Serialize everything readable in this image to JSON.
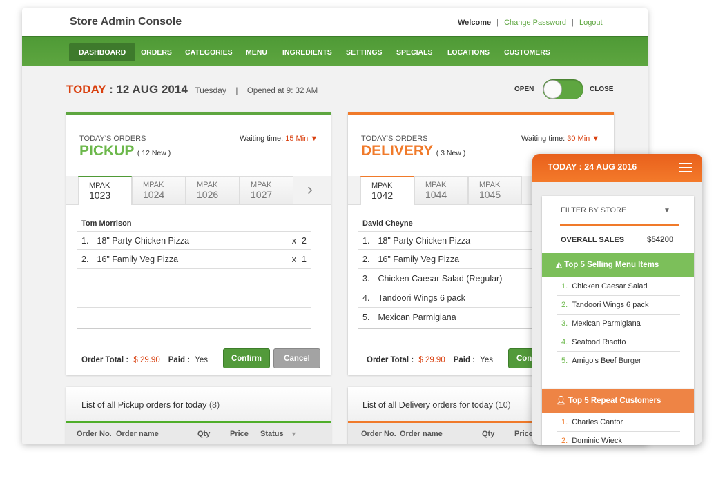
{
  "header": {
    "title": "Store Admin Console",
    "welcome": "Welcome",
    "sep": "|",
    "change_password": "Change Password",
    "logout": "Logout"
  },
  "nav": [
    "DASHBOARD",
    "ORDERS",
    "CATEGORIES",
    "MENU",
    "INGREDIENTS",
    "SETTINGS",
    "SPECIALS",
    "LOCATIONS",
    "CUSTOMERS"
  ],
  "date": {
    "today": "TODAY",
    "date": ": 12 AUG 2014",
    "day": "Tuesday",
    "sep": "|",
    "opened": "Opened at 9: 32 AM"
  },
  "toggle": {
    "open": "OPEN",
    "close": "CLOSE",
    "state": "open"
  },
  "pickup": {
    "subtitle": "TODAY'S ORDERS",
    "title": "PICKUP",
    "new": "( 12 New )",
    "waiting_label": "Waiting time:",
    "waiting": "15 Min",
    "tabs": [
      {
        "a": "MPAK",
        "b": "1023"
      },
      {
        "a": "MPAK",
        "b": "1024"
      },
      {
        "a": "MPAK",
        "b": "1026"
      },
      {
        "a": "MPAK",
        "b": "1027"
      }
    ],
    "customer": "Tom Morrison",
    "items": [
      {
        "n": "1.",
        "name": "18\" Party Chicken Pizza",
        "x": "x",
        "qty": "2"
      },
      {
        "n": "2.",
        "name": "16\" Family Veg Pizza",
        "x": "x",
        "qty": "1"
      }
    ],
    "total_label": "Order Total :",
    "total": "$ 29.90",
    "paid_label": "Paid :",
    "paid": "Yes",
    "confirm": "Confirm",
    "cancel": "Cancel"
  },
  "delivery": {
    "subtitle": "TODAY'S ORDERS",
    "title": "DELIVERY",
    "new": "( 3 New )",
    "waiting_label": "Waiting time:",
    "waiting": "30 Min",
    "tabs": [
      {
        "a": "MPAK",
        "b": "1042"
      },
      {
        "a": "MPAK",
        "b": "1044"
      },
      {
        "a": "MPAK",
        "b": "1045"
      }
    ],
    "customer": "David Cheyne",
    "items": [
      {
        "n": "1.",
        "name": "18\" Party Chicken Pizza"
      },
      {
        "n": "2.",
        "name": "16\" Family Veg Pizza"
      },
      {
        "n": "3.",
        "name": "Chicken Caesar Salad (Regular)"
      },
      {
        "n": "4.",
        "name": "Tandoori Wings 6 pack"
      },
      {
        "n": "5.",
        "name": "Mexican Parmigiana"
      }
    ],
    "total_label": "Order Total :",
    "total": "$ 29.90",
    "paid_label": "Paid :",
    "paid": "Yes",
    "confirm": "Confirm"
  },
  "pickup_list": {
    "title": "List of all Pickup orders for today",
    "count": "(8)",
    "cols": [
      "Order No.",
      "Order name",
      "Qty",
      "Price",
      "Status"
    ]
  },
  "delivery_list": {
    "title": "List of all Delivery orders for today",
    "count": "(10)",
    "cols": [
      "Order No.",
      "Order name",
      "Qty",
      "Price"
    ]
  },
  "mobile": {
    "date": "TODAY : 24 AUG 2016",
    "filter": "FILTER BY STORE",
    "sales_label": "OVERALL SALES",
    "sales": "$54200",
    "top_items_title": "Top 5 Selling Menu Items",
    "top_items": [
      {
        "n": "1.",
        "name": "Chicken Caesar Salad"
      },
      {
        "n": "2.",
        "name": "Tandoori Wings 6 pack"
      },
      {
        "n": "3.",
        "name": "Mexican Parmigiana"
      },
      {
        "n": "4.",
        "name": "Seafood Risotto"
      },
      {
        "n": "5.",
        "name": "Amigo's Beef Burger"
      }
    ],
    "customers_title": "Top 5 Repeat Customers",
    "customers": [
      {
        "n": "1.",
        "name": "Charles Cantor"
      },
      {
        "n": "2.",
        "name": "Dominic Wieck"
      }
    ]
  },
  "colors": {
    "green": "#5ea640",
    "orange": "#f07a2a",
    "red": "#d9400f"
  }
}
